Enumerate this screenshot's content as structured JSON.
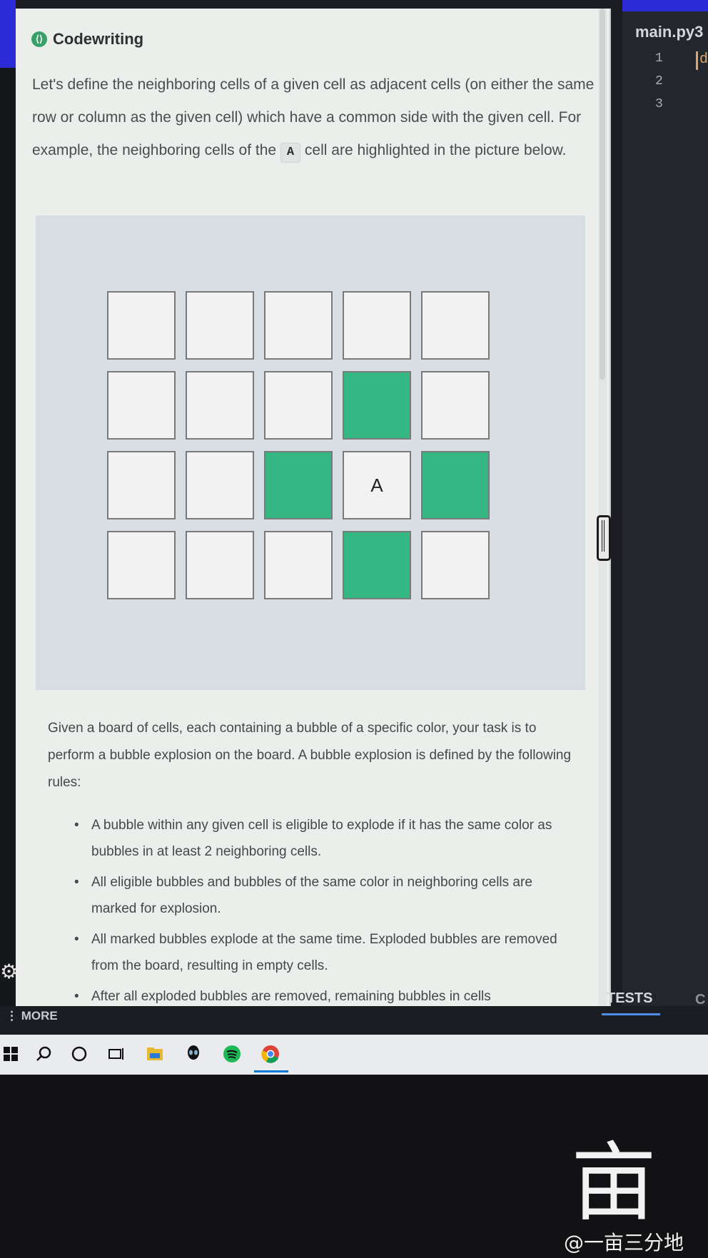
{
  "problem": {
    "title": "Codewriting",
    "intro_before": "Let's define the neighboring cells of a given cell as adjacent cells (on either the same row or column as the given cell) which have a common side with the given cell. For example, the neighboring cells of the ",
    "intro_code": "A",
    "intro_after": " cell are highlighted in the picture below.",
    "figure": {
      "rows": [
        [
          "",
          "",
          "",
          "",
          ""
        ],
        [
          "",
          "",
          "",
          "hl",
          ""
        ],
        [
          "",
          "",
          "hl",
          "A",
          "hl"
        ],
        [
          "",
          "",
          "",
          "hl",
          ""
        ]
      ],
      "highlight_color": "#35b783"
    },
    "description": "Given a board of cells, each containing a bubble of a specific color, your task is to perform a bubble explosion on the board. A bubble explosion is defined by the following rules:",
    "rules": [
      "A bubble within any given cell is eligible to explode if it has the same color as bubbles in at least 2 neighboring cells.",
      "All eligible bubbles and bubbles of the same color in neighboring cells are marked for explosion.",
      "All marked bubbles explode at the same time. Exploded bubbles are removed from the board, resulting in empty cells.",
      "After all exploded bubbles are removed, remaining bubbles in cells"
    ]
  },
  "editor": {
    "file_tab": "main.py3",
    "line_numbers": [
      "1",
      "2",
      "3"
    ],
    "code_fragment": "de",
    "bottom_tabs": [
      "TESTS",
      "C"
    ]
  },
  "bottom_bar": {
    "more_label": "MORE"
  },
  "taskbar": {
    "icons": [
      "windows-icon",
      "search-icon",
      "cortana-icon",
      "task-view-icon",
      "file-explorer-icon",
      "alienware-icon",
      "spotify-icon",
      "chrome-icon"
    ]
  },
  "watermark": {
    "char": "亩",
    "text": "@一亩三分地"
  },
  "colors": {
    "accent_blue": "#2b2bd8",
    "highlight_green": "#35b783"
  }
}
